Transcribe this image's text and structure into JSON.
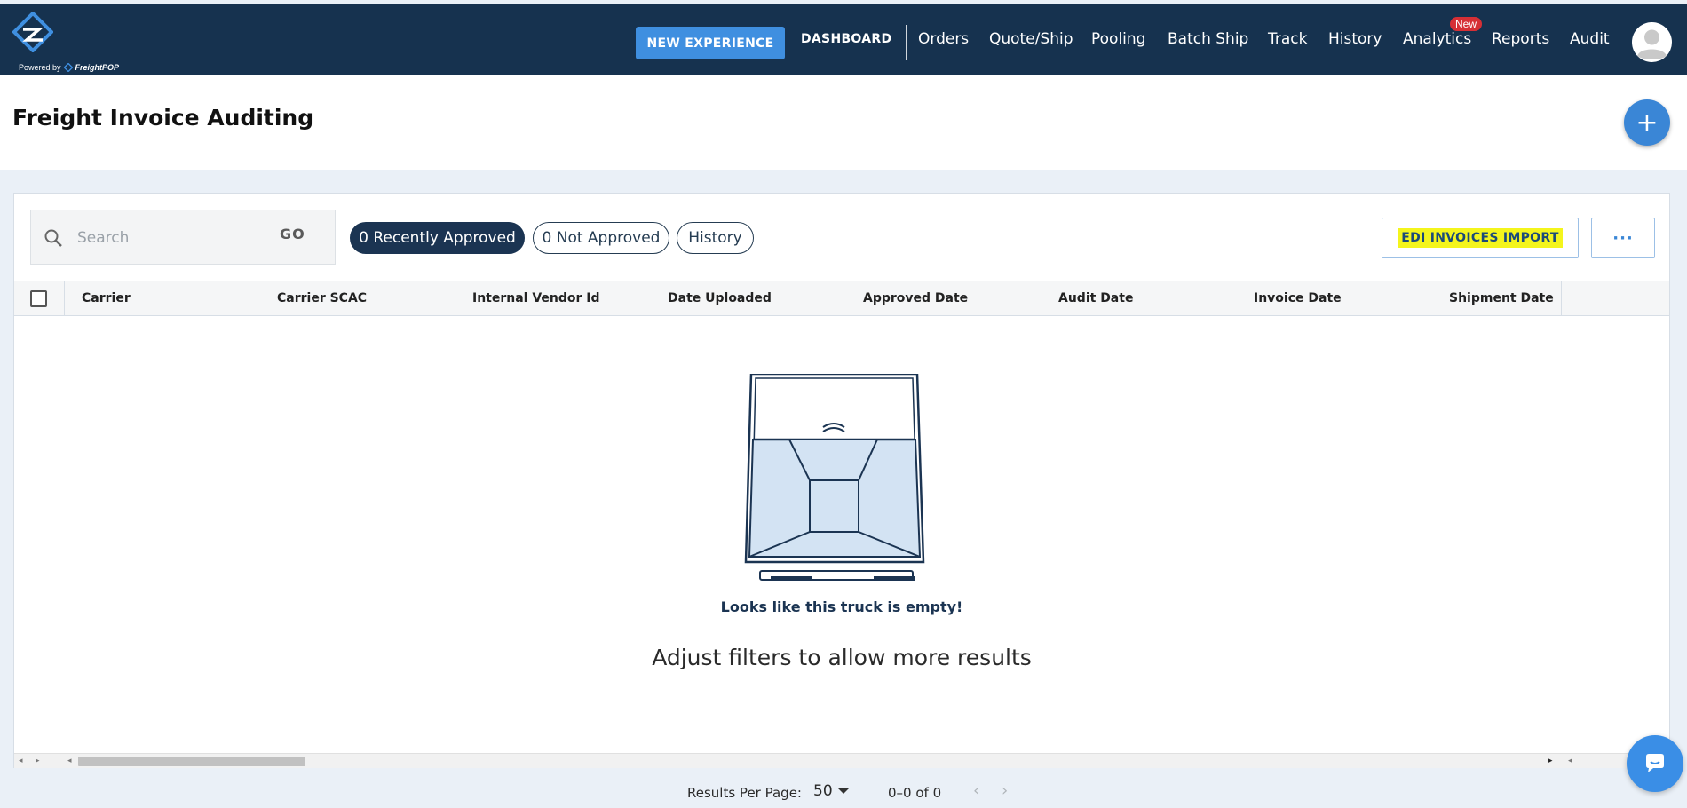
{
  "header": {
    "powered_by": "Powered by",
    "powered_brand": "FreightPOP",
    "new_experience": "NEW EXPERIENCE",
    "dashboard": "DASHBOARD",
    "nav": [
      "Orders",
      "Quote/Ship",
      "Pooling",
      "Batch Ship",
      "Track",
      "History",
      "Analytics",
      "Reports",
      "Audit"
    ],
    "new_badge": "New"
  },
  "page": {
    "title": "Freight Invoice Auditing",
    "add_label": "+"
  },
  "toolbar": {
    "search_placeholder": "Search",
    "go_label": "GO",
    "filters": [
      "0 Recently Approved",
      "0 Not Approved",
      "History"
    ],
    "edi_import": "EDI INVOICES IMPORT",
    "more_label": "···"
  },
  "table": {
    "columns": [
      "Carrier",
      "Carrier SCAC",
      "Internal Vendor Id",
      "Date Uploaded",
      "Approved Date",
      "Audit Date",
      "Invoice Date",
      "Shipment Date"
    ]
  },
  "empty_state": {
    "title": "Looks like this truck is empty!",
    "subtitle": "Adjust filters to allow more results"
  },
  "pagination": {
    "per_page_label": "Results Per Page:",
    "per_page_value": "50",
    "range": "0–0 of 0"
  },
  "colors": {
    "nav_bg": "#16324f",
    "accent": "#3f8fe0",
    "active_pill": "#1b3452",
    "highlight": "#f4f51c",
    "badge": "#d62f35"
  }
}
